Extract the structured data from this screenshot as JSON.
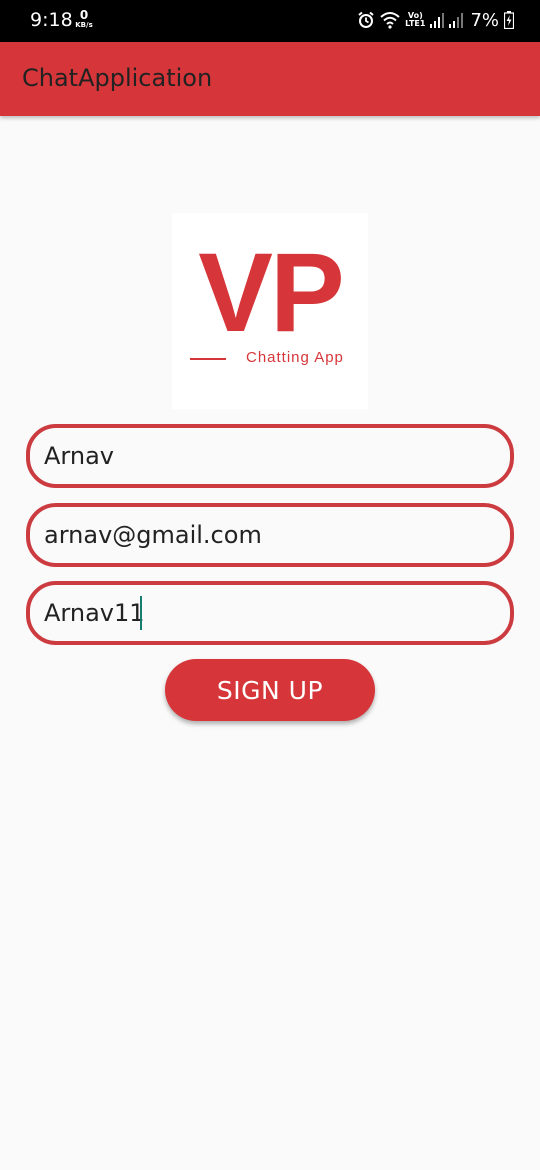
{
  "status_bar": {
    "time": "9:18",
    "net_speed_value": "0",
    "net_speed_unit": "KB/s",
    "volte_top": "Vo)",
    "volte_bottom": "LTE1",
    "battery_percent": "7%"
  },
  "app_bar": {
    "title": "ChatApplication"
  },
  "logo": {
    "letters": "VP",
    "tagline": "Chatting App",
    "color": "#d63639"
  },
  "form": {
    "name_value": "Arnav",
    "email_value": "arnav@gmail.com",
    "password_value": "Arnav11",
    "signup_label": "SIGN UP"
  },
  "colors": {
    "accent": "#d63639",
    "field_border": "#cc3b3f",
    "background": "#fafafa",
    "caret": "#167d71"
  }
}
